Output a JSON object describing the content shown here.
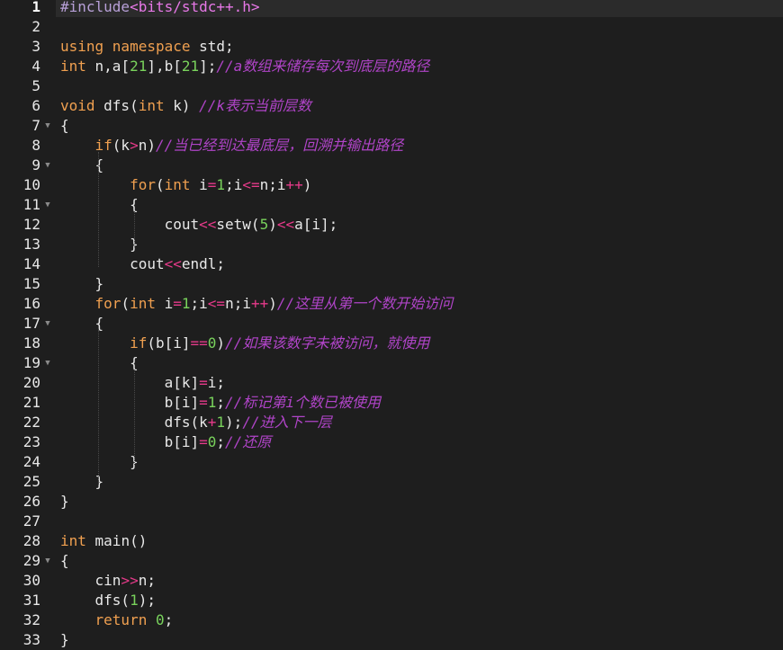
{
  "editor": {
    "colors": {
      "background": "#1e1e1e",
      "keyword": "#f0a050",
      "number": "#79d35c",
      "operator": "#e63a8a",
      "comment": "#b044c8",
      "preprocessor": "#b8a0d8",
      "include_path": "#e878e8"
    },
    "active_line": 1,
    "fold_icon": "fold-triangle-icon",
    "lines": [
      {
        "n": "1",
        "fold": false,
        "tokens": [
          {
            "t": "#include",
            "c": "pre"
          },
          {
            "t": "<bits/stdc++.h>",
            "c": "inc"
          }
        ]
      },
      {
        "n": "2",
        "fold": false,
        "tokens": []
      },
      {
        "n": "3",
        "fold": false,
        "tokens": [
          {
            "t": "using namespace",
            "c": "kw"
          },
          {
            "t": " std;",
            "c": "id"
          }
        ]
      },
      {
        "n": "4",
        "fold": false,
        "tokens": [
          {
            "t": "int",
            "c": "kw"
          },
          {
            "t": " n,a[",
            "c": "id"
          },
          {
            "t": "21",
            "c": "num"
          },
          {
            "t": "],b[",
            "c": "id"
          },
          {
            "t": "21",
            "c": "num"
          },
          {
            "t": "];",
            "c": "id"
          },
          {
            "t": "//a数组来储存每次到底层的路径",
            "c": "cmt"
          }
        ]
      },
      {
        "n": "5",
        "fold": false,
        "tokens": []
      },
      {
        "n": "6",
        "fold": false,
        "tokens": [
          {
            "t": "void",
            "c": "kw"
          },
          {
            "t": " dfs(",
            "c": "id"
          },
          {
            "t": "int",
            "c": "kw"
          },
          {
            "t": " k) ",
            "c": "id"
          },
          {
            "t": "//k表示当前层数",
            "c": "cmt"
          }
        ]
      },
      {
        "n": "7",
        "fold": true,
        "tokens": [
          {
            "t": "{",
            "c": "id"
          }
        ]
      },
      {
        "n": "8",
        "fold": false,
        "tokens": [
          {
            "t": "    ",
            "c": "id"
          },
          {
            "t": "if",
            "c": "kw"
          },
          {
            "t": "(k",
            "c": "id"
          },
          {
            "t": ">",
            "c": "op"
          },
          {
            "t": "n)",
            "c": "id"
          },
          {
            "t": "//当已经到达最底层，回溯并输出路径",
            "c": "cmt"
          }
        ]
      },
      {
        "n": "9",
        "fold": true,
        "tokens": [
          {
            "t": "    {",
            "c": "id"
          }
        ]
      },
      {
        "n": "10",
        "fold": false,
        "tokens": [
          {
            "t": "        ",
            "c": "id"
          },
          {
            "t": "for",
            "c": "kw"
          },
          {
            "t": "(",
            "c": "id"
          },
          {
            "t": "int",
            "c": "kw"
          },
          {
            "t": " i",
            "c": "id"
          },
          {
            "t": "=",
            "c": "op"
          },
          {
            "t": "1",
            "c": "num"
          },
          {
            "t": ";i",
            "c": "id"
          },
          {
            "t": "<=",
            "c": "op"
          },
          {
            "t": "n;i",
            "c": "id"
          },
          {
            "t": "++",
            "c": "op"
          },
          {
            "t": ")",
            "c": "id"
          }
        ]
      },
      {
        "n": "11",
        "fold": true,
        "tokens": [
          {
            "t": "        {",
            "c": "id"
          }
        ]
      },
      {
        "n": "12",
        "fold": false,
        "tokens": [
          {
            "t": "            cout",
            "c": "id"
          },
          {
            "t": "<<",
            "c": "op"
          },
          {
            "t": "setw(",
            "c": "id"
          },
          {
            "t": "5",
            "c": "num"
          },
          {
            "t": ")",
            "c": "id"
          },
          {
            "t": "<<",
            "c": "op"
          },
          {
            "t": "a[i];",
            "c": "id"
          }
        ]
      },
      {
        "n": "13",
        "fold": false,
        "tokens": [
          {
            "t": "        }",
            "c": "id"
          }
        ]
      },
      {
        "n": "14",
        "fold": false,
        "tokens": [
          {
            "t": "        cout",
            "c": "id"
          },
          {
            "t": "<<",
            "c": "op"
          },
          {
            "t": "endl;",
            "c": "id"
          }
        ]
      },
      {
        "n": "15",
        "fold": false,
        "tokens": [
          {
            "t": "    }",
            "c": "id"
          }
        ]
      },
      {
        "n": "16",
        "fold": false,
        "tokens": [
          {
            "t": "    ",
            "c": "id"
          },
          {
            "t": "for",
            "c": "kw"
          },
          {
            "t": "(",
            "c": "id"
          },
          {
            "t": "int",
            "c": "kw"
          },
          {
            "t": " i",
            "c": "id"
          },
          {
            "t": "=",
            "c": "op"
          },
          {
            "t": "1",
            "c": "num"
          },
          {
            "t": ";i",
            "c": "id"
          },
          {
            "t": "<=",
            "c": "op"
          },
          {
            "t": "n;i",
            "c": "id"
          },
          {
            "t": "++",
            "c": "op"
          },
          {
            "t": ")",
            "c": "id"
          },
          {
            "t": "//这里从第一个数开始访问",
            "c": "cmt"
          }
        ]
      },
      {
        "n": "17",
        "fold": true,
        "tokens": [
          {
            "t": "    {",
            "c": "id"
          }
        ]
      },
      {
        "n": "18",
        "fold": false,
        "tokens": [
          {
            "t": "        ",
            "c": "id"
          },
          {
            "t": "if",
            "c": "kw"
          },
          {
            "t": "(b[i]",
            "c": "id"
          },
          {
            "t": "==",
            "c": "op"
          },
          {
            "t": "0",
            "c": "num"
          },
          {
            "t": ")",
            "c": "id"
          },
          {
            "t": "//如果该数字未被访问，就使用",
            "c": "cmt"
          }
        ]
      },
      {
        "n": "19",
        "fold": true,
        "tokens": [
          {
            "t": "        {",
            "c": "id"
          }
        ]
      },
      {
        "n": "20",
        "fold": false,
        "tokens": [
          {
            "t": "            a[k]",
            "c": "id"
          },
          {
            "t": "=",
            "c": "op"
          },
          {
            "t": "i;",
            "c": "id"
          }
        ]
      },
      {
        "n": "21",
        "fold": false,
        "tokens": [
          {
            "t": "            b[i]",
            "c": "id"
          },
          {
            "t": "=",
            "c": "op"
          },
          {
            "t": "1",
            "c": "num"
          },
          {
            "t": ";",
            "c": "id"
          },
          {
            "t": "//标记第i个数已被使用",
            "c": "cmt"
          }
        ]
      },
      {
        "n": "22",
        "fold": false,
        "tokens": [
          {
            "t": "            dfs(k",
            "c": "id"
          },
          {
            "t": "+",
            "c": "op"
          },
          {
            "t": "1",
            "c": "num"
          },
          {
            "t": ");",
            "c": "id"
          },
          {
            "t": "//进入下一层",
            "c": "cmt"
          }
        ]
      },
      {
        "n": "23",
        "fold": false,
        "tokens": [
          {
            "t": "            b[i]",
            "c": "id"
          },
          {
            "t": "=",
            "c": "op"
          },
          {
            "t": "0",
            "c": "num"
          },
          {
            "t": ";",
            "c": "id"
          },
          {
            "t": "//还原",
            "c": "cmt"
          }
        ]
      },
      {
        "n": "24",
        "fold": false,
        "tokens": [
          {
            "t": "        }",
            "c": "id"
          }
        ]
      },
      {
        "n": "25",
        "fold": false,
        "tokens": [
          {
            "t": "    }",
            "c": "id"
          }
        ]
      },
      {
        "n": "26",
        "fold": false,
        "tokens": [
          {
            "t": "}",
            "c": "id"
          }
        ]
      },
      {
        "n": "27",
        "fold": false,
        "tokens": []
      },
      {
        "n": "28",
        "fold": false,
        "tokens": [
          {
            "t": "int",
            "c": "kw"
          },
          {
            "t": " main()",
            "c": "id"
          }
        ]
      },
      {
        "n": "29",
        "fold": true,
        "tokens": [
          {
            "t": "{",
            "c": "id"
          }
        ]
      },
      {
        "n": "30",
        "fold": false,
        "tokens": [
          {
            "t": "    cin",
            "c": "id"
          },
          {
            "t": ">>",
            "c": "op"
          },
          {
            "t": "n;",
            "c": "id"
          }
        ]
      },
      {
        "n": "31",
        "fold": false,
        "tokens": [
          {
            "t": "    dfs(",
            "c": "id"
          },
          {
            "t": "1",
            "c": "num"
          },
          {
            "t": ");",
            "c": "id"
          }
        ]
      },
      {
        "n": "32",
        "fold": false,
        "tokens": [
          {
            "t": "    ",
            "c": "id"
          },
          {
            "t": "return",
            "c": "kw"
          },
          {
            "t": " ",
            "c": "id"
          },
          {
            "t": "0",
            "c": "num"
          },
          {
            "t": ";",
            "c": "id"
          }
        ]
      },
      {
        "n": "33",
        "fold": false,
        "tokens": [
          {
            "t": "}",
            "c": "id"
          }
        ]
      }
    ]
  }
}
